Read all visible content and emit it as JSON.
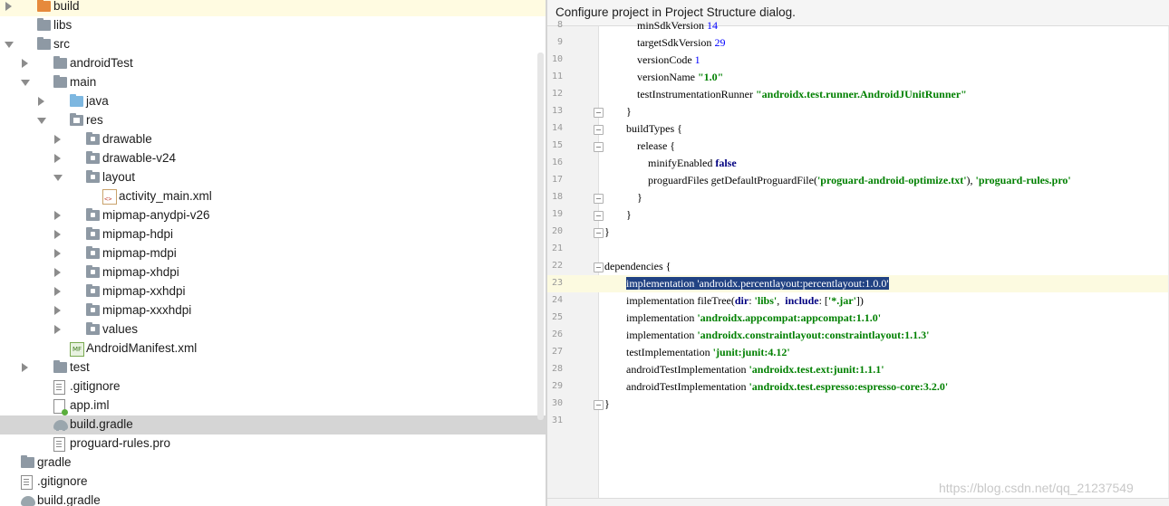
{
  "tree": {
    "rows": [
      {
        "label": "build",
        "indent": 0,
        "arrow": "right",
        "icon": "folder-orange"
      },
      {
        "label": "libs",
        "indent": 0,
        "arrow": "none",
        "icon": "folder"
      },
      {
        "label": "src",
        "indent": 0,
        "arrow": "down",
        "icon": "folder"
      },
      {
        "label": "androidTest",
        "indent": 1,
        "arrow": "right",
        "icon": "folder"
      },
      {
        "label": "main",
        "indent": 1,
        "arrow": "down",
        "icon": "folder"
      },
      {
        "label": "java",
        "indent": 2,
        "arrow": "right",
        "icon": "folder-blue"
      },
      {
        "label": "res",
        "indent": 2,
        "arrow": "down",
        "icon": "folder-res"
      },
      {
        "label": "drawable",
        "indent": 3,
        "arrow": "right",
        "icon": "folder-inner"
      },
      {
        "label": "drawable-v24",
        "indent": 3,
        "arrow": "right",
        "icon": "folder-inner"
      },
      {
        "label": "layout",
        "indent": 3,
        "arrow": "down",
        "icon": "folder-inner"
      },
      {
        "label": "activity_main.xml",
        "indent": 4,
        "arrow": "none",
        "icon": "xml"
      },
      {
        "label": "mipmap-anydpi-v26",
        "indent": 3,
        "arrow": "right",
        "icon": "folder-inner"
      },
      {
        "label": "mipmap-hdpi",
        "indent": 3,
        "arrow": "right",
        "icon": "folder-inner"
      },
      {
        "label": "mipmap-mdpi",
        "indent": 3,
        "arrow": "right",
        "icon": "folder-inner"
      },
      {
        "label": "mipmap-xhdpi",
        "indent": 3,
        "arrow": "right",
        "icon": "folder-inner"
      },
      {
        "label": "mipmap-xxhdpi",
        "indent": 3,
        "arrow": "right",
        "icon": "folder-inner"
      },
      {
        "label": "mipmap-xxxhdpi",
        "indent": 3,
        "arrow": "right",
        "icon": "folder-inner"
      },
      {
        "label": "values",
        "indent": 3,
        "arrow": "right",
        "icon": "folder-inner"
      },
      {
        "label": "AndroidManifest.xml",
        "indent": 2,
        "arrow": "none",
        "icon": "manifest"
      },
      {
        "label": "test",
        "indent": 1,
        "arrow": "right",
        "icon": "folder"
      },
      {
        "label": ".gitignore",
        "indent": 1,
        "arrow": "none",
        "icon": "file"
      },
      {
        "label": "app.iml",
        "indent": 1,
        "arrow": "none",
        "icon": "iml"
      },
      {
        "label": "build.gradle",
        "indent": 1,
        "arrow": "none",
        "icon": "gradle",
        "selected": true
      },
      {
        "label": "proguard-rules.pro",
        "indent": 1,
        "arrow": "none",
        "icon": "file"
      },
      {
        "label": "gradle",
        "indent": 0,
        "arrow": "right",
        "icon": "folder",
        "level": -1
      },
      {
        "label": ".gitignore",
        "indent": 0,
        "arrow": "none",
        "icon": "file",
        "level": -1
      },
      {
        "label": "build.gradle",
        "indent": 0,
        "arrow": "none",
        "icon": "gradle",
        "level": -1
      }
    ]
  },
  "editor": {
    "banner": "Configure project in Project Structure dialog.",
    "lines": [
      {
        "n": "8",
        "tokens": [
          {
            "t": "            minSdkVersion "
          },
          {
            "t": "14",
            "c": "num"
          }
        ]
      },
      {
        "n": "9",
        "tokens": [
          {
            "t": "            targetSdkVersion "
          },
          {
            "t": "29",
            "c": "num"
          }
        ]
      },
      {
        "n": "10",
        "tokens": [
          {
            "t": "            versionCode "
          },
          {
            "t": "1",
            "c": "num"
          }
        ]
      },
      {
        "n": "11",
        "tokens": [
          {
            "t": "            versionName "
          },
          {
            "t": "\"1.0\"",
            "c": "str"
          }
        ]
      },
      {
        "n": "12",
        "tokens": [
          {
            "t": "            testInstrumentationRunner "
          },
          {
            "t": "\"androidx.test.runner.AndroidJUnitRunner\"",
            "c": "str"
          }
        ]
      },
      {
        "n": "13",
        "fold": true,
        "tokens": [
          {
            "t": "        }"
          }
        ]
      },
      {
        "n": "14",
        "fold": true,
        "tokens": [
          {
            "t": "        buildTypes {"
          }
        ]
      },
      {
        "n": "15",
        "fold": true,
        "tokens": [
          {
            "t": "            release {"
          }
        ]
      },
      {
        "n": "16",
        "tokens": [
          {
            "t": "                minifyEnabled "
          },
          {
            "t": "false",
            "c": "kw"
          }
        ]
      },
      {
        "n": "17",
        "tokens": [
          {
            "t": "                proguardFiles getDefaultProguardFile("
          },
          {
            "t": "'proguard-android-optimize.txt'",
            "c": "str"
          },
          {
            "t": "), "
          },
          {
            "t": "'proguard-rules.pro'",
            "c": "str"
          }
        ]
      },
      {
        "n": "18",
        "fold": true,
        "tokens": [
          {
            "t": "            }"
          }
        ]
      },
      {
        "n": "19",
        "fold": true,
        "tokens": [
          {
            "t": "        }"
          }
        ]
      },
      {
        "n": "20",
        "fold": true,
        "tokens": [
          {
            "t": "}"
          }
        ]
      },
      {
        "n": "21",
        "tokens": [
          {
            "t": ""
          }
        ]
      },
      {
        "n": "22",
        "fold": true,
        "tokens": [
          {
            "t": "dependencies {"
          }
        ]
      },
      {
        "n": "23",
        "current": true,
        "tokens": [
          {
            "t": "        "
          },
          {
            "t": "implementation 'androidx.percentlayout:percentlayout:1.0.0'",
            "c": "sel"
          }
        ]
      },
      {
        "n": "24",
        "tokens": [
          {
            "t": "        implementation fileTree("
          },
          {
            "t": "dir",
            "c": "kw"
          },
          {
            "t": ": "
          },
          {
            "t": "'libs'",
            "c": "str"
          },
          {
            "t": ",  "
          },
          {
            "t": "include",
            "c": "kw"
          },
          {
            "t": ": ["
          },
          {
            "t": "'*.jar'",
            "c": "str"
          },
          {
            "t": "])"
          }
        ]
      },
      {
        "n": "25",
        "tokens": [
          {
            "t": "        implementation "
          },
          {
            "t": "'androidx.appcompat:appcompat:1.1.0'",
            "c": "str"
          }
        ]
      },
      {
        "n": "26",
        "tokens": [
          {
            "t": "        implementation "
          },
          {
            "t": "'androidx.constraintlayout:constraintlayout:1.1.3'",
            "c": "str"
          }
        ]
      },
      {
        "n": "27",
        "tokens": [
          {
            "t": "        testImplementation "
          },
          {
            "t": "'junit:junit:4.12'",
            "c": "str"
          }
        ]
      },
      {
        "n": "28",
        "tokens": [
          {
            "t": "        androidTestImplementation "
          },
          {
            "t": "'androidx.test.ext:junit:1.1.1'",
            "c": "str"
          }
        ]
      },
      {
        "n": "29",
        "tokens": [
          {
            "t": "        androidTestImplementation "
          },
          {
            "t": "'androidx.test.espresso:espresso-core:3.2.0'",
            "c": "str"
          }
        ]
      },
      {
        "n": "30",
        "fold": true,
        "tokens": [
          {
            "t": "}"
          }
        ]
      },
      {
        "n": "31",
        "tokens": [
          {
            "t": ""
          }
        ]
      }
    ],
    "watermark": "https://blog.csdn.net/qq_21237549"
  },
  "colors": {
    "selection": "#214283",
    "string": "#008000",
    "keyword": "#000080",
    "number": "#0000ff",
    "selected_row": "#d5d5d5",
    "highlight_row": "#fffbe1"
  }
}
